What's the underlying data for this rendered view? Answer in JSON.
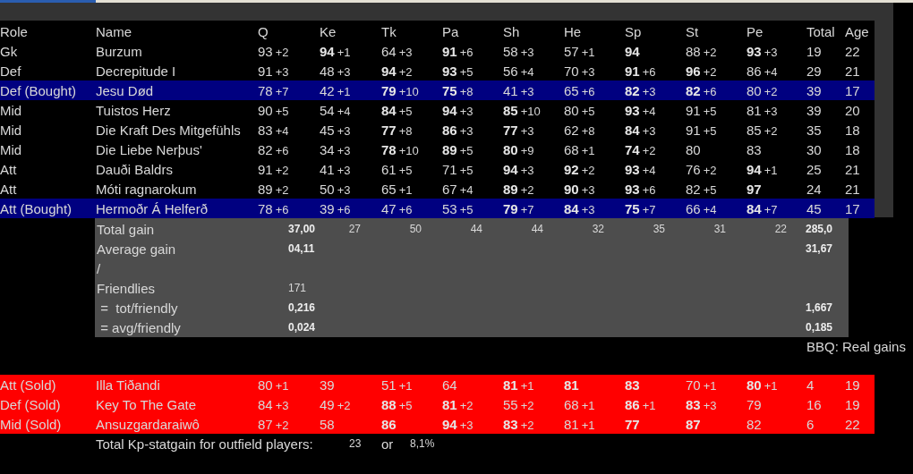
{
  "roster": {
    "kind": "roster",
    "columns": [
      "Role",
      "Name",
      "Q",
      "Ke",
      "Tk",
      "Pa",
      "Sh",
      "He",
      "Sp",
      "St",
      "Pe",
      "Total",
      "Age"
    ],
    "rows": [
      {
        "role": "Gk",
        "name": "Burzum",
        "highlighted": false,
        "stats": [
          {
            "value": "93",
            "gain": "+2",
            "bold": false
          },
          {
            "value": "94",
            "gain": "+1",
            "bold": true
          },
          {
            "value": "64",
            "gain": "+3",
            "bold": false
          },
          {
            "value": "91",
            "gain": "+6",
            "bold": true
          },
          {
            "value": "58",
            "gain": "+3",
            "bold": false
          },
          {
            "value": "57",
            "gain": "+1",
            "bold": false
          },
          {
            "value": "94",
            "bold": true
          },
          {
            "value": "88",
            "gain": "+2",
            "bold": false
          },
          {
            "value": "93",
            "gain": "+3",
            "bold": true
          }
        ],
        "total": "19",
        "age": "22"
      },
      {
        "role": "Def",
        "name": "Decrepitude I",
        "highlighted": false,
        "stats": [
          {
            "value": "91",
            "gain": "+3",
            "bold": false
          },
          {
            "value": "48",
            "gain": "+3",
            "bold": false
          },
          {
            "value": "94",
            "gain": "+2",
            "bold": true
          },
          {
            "value": "93",
            "gain": "+5",
            "bold": true
          },
          {
            "value": "56",
            "gain": "+4",
            "bold": false
          },
          {
            "value": "70",
            "gain": "+3",
            "bold": false
          },
          {
            "value": "91",
            "gain": "+6",
            "bold": true
          },
          {
            "value": "96",
            "gain": "+2",
            "bold": true
          },
          {
            "value": "86",
            "gain": "+4",
            "bold": false
          }
        ],
        "total": "29",
        "age": "21"
      },
      {
        "role": "Def (Bought)",
        "name": "Jesu Død",
        "highlighted": true,
        "stats": [
          {
            "value": "78",
            "gain": "+7",
            "bold": false
          },
          {
            "value": "42",
            "gain": "+1",
            "bold": false
          },
          {
            "value": "79",
            "gain": "+10",
            "bold": true
          },
          {
            "value": "75",
            "gain": "+8",
            "bold": true
          },
          {
            "value": "41",
            "gain": "+3",
            "bold": false
          },
          {
            "value": "65",
            "gain": "+6",
            "bold": false
          },
          {
            "value": "82",
            "gain": "+3",
            "bold": true
          },
          {
            "value": "82",
            "gain": "+6",
            "bold": true
          },
          {
            "value": "80",
            "gain": "+2",
            "bold": false
          }
        ],
        "total": "39",
        "age": "17"
      },
      {
        "role": "Mid",
        "name": "Tuistos Herz",
        "highlighted": false,
        "stats": [
          {
            "value": "90",
            "gain": "+5",
            "bold": false
          },
          {
            "value": "54",
            "gain": "+4",
            "bold": false
          },
          {
            "value": "84",
            "gain": "+5",
            "bold": true
          },
          {
            "value": "94",
            "gain": "+3",
            "bold": true
          },
          {
            "value": "85",
            "gain": "+10",
            "bold": true
          },
          {
            "value": "80",
            "gain": "+5",
            "bold": false
          },
          {
            "value": "93",
            "gain": "+4",
            "bold": true
          },
          {
            "value": "91",
            "gain": "+5",
            "bold": false
          },
          {
            "value": "81",
            "gain": "+3",
            "bold": false
          }
        ],
        "total": "39",
        "age": "20"
      },
      {
        "role": "Mid",
        "name": "Die Kraft Des Mitgefühls",
        "highlighted": false,
        "stats": [
          {
            "value": "83",
            "gain": "+4",
            "bold": false
          },
          {
            "value": "45",
            "gain": "+3",
            "bold": false
          },
          {
            "value": "77",
            "gain": "+8",
            "bold": true
          },
          {
            "value": "86",
            "gain": "+3",
            "bold": true
          },
          {
            "value": "77",
            "gain": "+3",
            "bold": true
          },
          {
            "value": "62",
            "gain": "+8",
            "bold": false
          },
          {
            "value": "84",
            "gain": "+3",
            "bold": true
          },
          {
            "value": "91",
            "gain": "+5",
            "bold": false
          },
          {
            "value": "85",
            "gain": "+2",
            "bold": false
          }
        ],
        "total": "35",
        "age": "18"
      },
      {
        "role": "Mid",
        "name": "Die Liebe Nerþus'",
        "highlighted": false,
        "stats": [
          {
            "value": "82",
            "gain": "+6",
            "bold": false
          },
          {
            "value": "34",
            "gain": "+3",
            "bold": false
          },
          {
            "value": "78",
            "gain": "+10",
            "bold": true
          },
          {
            "value": "89",
            "gain": "+5",
            "bold": true
          },
          {
            "value": "80",
            "gain": "+9",
            "bold": true
          },
          {
            "value": "68",
            "gain": "+1",
            "bold": false
          },
          {
            "value": "74",
            "gain": "+2",
            "bold": true
          },
          {
            "value": "80",
            "bold": false
          },
          {
            "value": "83",
            "bold": false
          }
        ],
        "total": "30",
        "age": "18"
      },
      {
        "role": "Att",
        "name": "Dauði Baldrs",
        "highlighted": false,
        "stats": [
          {
            "value": "91",
            "gain": "+2",
            "bold": false
          },
          {
            "value": "41",
            "gain": "+3",
            "bold": false
          },
          {
            "value": "61",
            "gain": "+5",
            "bold": false
          },
          {
            "value": "71",
            "gain": "+5",
            "bold": false
          },
          {
            "value": "94",
            "gain": "+3",
            "bold": true
          },
          {
            "value": "92",
            "gain": "+2",
            "bold": true
          },
          {
            "value": "93",
            "gain": "+4",
            "bold": true
          },
          {
            "value": "76",
            "gain": "+2",
            "bold": false
          },
          {
            "value": "94",
            "gain": "+1",
            "bold": true
          }
        ],
        "total": "25",
        "age": "21"
      },
      {
        "role": "Att",
        "name": "Móti ragnarokum",
        "highlighted": false,
        "stats": [
          {
            "value": "89",
            "gain": "+2",
            "bold": false
          },
          {
            "value": "50",
            "gain": "+3",
            "bold": false
          },
          {
            "value": "65",
            "gain": "+1",
            "bold": false
          },
          {
            "value": "67",
            "gain": "+4",
            "bold": false
          },
          {
            "value": "89",
            "gain": "+2",
            "bold": true
          },
          {
            "value": "90",
            "gain": "+3",
            "bold": true
          },
          {
            "value": "93",
            "gain": "+6",
            "bold": true
          },
          {
            "value": "82",
            "gain": "+5",
            "bold": false
          },
          {
            "value": "97",
            "bold": true
          }
        ],
        "total": "24",
        "age": "21"
      },
      {
        "role": "Att (Bought)",
        "name": "Hermoðr Á Helferð",
        "highlighted": true,
        "stats": [
          {
            "value": "78",
            "gain": "+6",
            "bold": false
          },
          {
            "value": "39",
            "gain": "+6",
            "bold": false
          },
          {
            "value": "47",
            "gain": "+6",
            "bold": false
          },
          {
            "value": "53",
            "gain": "+5",
            "bold": false
          },
          {
            "value": "79",
            "gain": "+7",
            "bold": true
          },
          {
            "value": "84",
            "gain": "+3",
            "bold": true
          },
          {
            "value": "75",
            "gain": "+7",
            "bold": true
          },
          {
            "value": "66",
            "gain": "+4",
            "bold": false
          },
          {
            "value": "84",
            "gain": "+7",
            "bold": true
          }
        ],
        "total": "45",
        "age": "17"
      }
    ]
  },
  "summary": {
    "rows": [
      {
        "label": "Total gain",
        "first": "37,00",
        "first_bold": true,
        "stats": [
          "27",
          "50",
          "44",
          "44",
          "32",
          "35",
          "31",
          "22"
        ],
        "total": "285,0"
      },
      {
        "label": "Average gain",
        "first": "04,11",
        "first_bold": true,
        "total": "31,67"
      },
      {
        "label": "/"
      },
      {
        "label": "Friendlies",
        "first": "171",
        "first_bold": false
      },
      {
        "label": " =  tot/friendly",
        "first": "0,216",
        "first_bold": true,
        "total": "1,667"
      },
      {
        "label": " = avg/friendly",
        "first": "0,024",
        "first_bold": true,
        "total": "0,185"
      }
    ]
  },
  "note": "BBQ: Real gains",
  "sold": {
    "kind": "sold",
    "rows": [
      {
        "role": "Att (Sold)",
        "name": "Illa Tiðandi",
        "stats": [
          {
            "value": "80",
            "gain": "+1",
            "bold": false
          },
          {
            "value": "39",
            "bold": false
          },
          {
            "value": "51",
            "gain": "+1",
            "bold": false
          },
          {
            "value": "64",
            "bold": false
          },
          {
            "value": "81",
            "gain": "+1",
            "bold": true
          },
          {
            "value": "81",
            "bold": true
          },
          {
            "value": "83",
            "bold": true
          },
          {
            "value": "70",
            "gain": "+1",
            "bold": false
          },
          {
            "value": "80",
            "gain": "+1",
            "bold": true
          }
        ],
        "total": "4",
        "age": "19"
      },
      {
        "role": "Def (Sold)",
        "name": "Key To The Gate",
        "stats": [
          {
            "value": "84",
            "gain": "+3",
            "bold": false
          },
          {
            "value": "49",
            "gain": "+2",
            "bold": false
          },
          {
            "value": "88",
            "gain": "+5",
            "bold": true
          },
          {
            "value": "81",
            "gain": "+2",
            "bold": true
          },
          {
            "value": "55",
            "gain": "+2",
            "bold": false
          },
          {
            "value": "68",
            "gain": "+1",
            "bold": false
          },
          {
            "value": "86",
            "gain": "+1",
            "bold": true
          },
          {
            "value": "83",
            "gain": "+3",
            "bold": true
          },
          {
            "value": "79",
            "bold": false
          }
        ],
        "total": "16",
        "age": "19"
      },
      {
        "role": "Mid (Sold)",
        "name": "Ansuzgardaraiwô",
        "stats": [
          {
            "value": "87",
            "gain": "+2",
            "bold": false
          },
          {
            "value": "58",
            "bold": false
          },
          {
            "value": "86",
            "bold": true
          },
          {
            "value": "94",
            "gain": "+3",
            "bold": true
          },
          {
            "value": "83",
            "gain": "+2",
            "bold": true
          },
          {
            "value": "81",
            "gain": "+1",
            "bold": false
          },
          {
            "value": "77",
            "bold": true
          },
          {
            "value": "87",
            "bold": true
          },
          {
            "value": "82",
            "bold": false
          }
        ],
        "total": "6",
        "age": "22"
      }
    ]
  },
  "footer": {
    "label": "Total Kp-statgain for outfield players:",
    "count": "23",
    "conjunction": "or",
    "percent": "8,1%"
  }
}
